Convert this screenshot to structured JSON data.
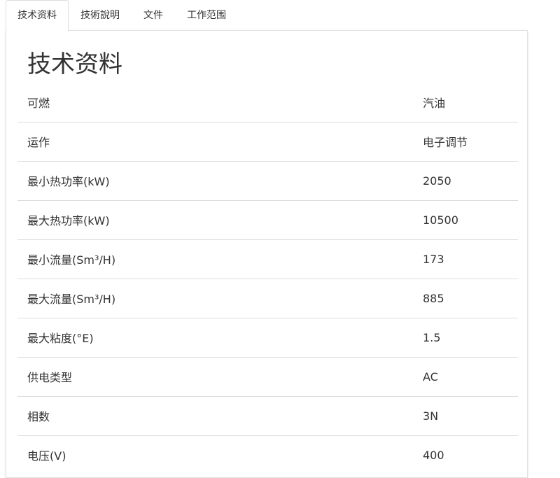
{
  "tabs": [
    {
      "label": "技术资料",
      "active": true
    },
    {
      "label": "技術說明",
      "active": false
    },
    {
      "label": "文件",
      "active": false
    },
    {
      "label": "工作范围",
      "active": false
    }
  ],
  "panel": {
    "title": "技术资料",
    "rows": [
      {
        "label": "可燃",
        "value": "汽油"
      },
      {
        "label": "运作",
        "value": "电子调节"
      },
      {
        "label": "最小热功率(kW)",
        "value": "2050"
      },
      {
        "label": "最大热功率(kW)",
        "value": "10500"
      },
      {
        "label": "最小流量(Sm³/H)",
        "value": "173"
      },
      {
        "label": "最大流量(Sm³/H)",
        "value": "885"
      },
      {
        "label": "最大粘度(°E)",
        "value": "1.5"
      },
      {
        "label": "供电类型",
        "value": "AC"
      },
      {
        "label": "相数",
        "value": "3N"
      },
      {
        "label": "电压(V)",
        "value": "400"
      }
    ]
  }
}
